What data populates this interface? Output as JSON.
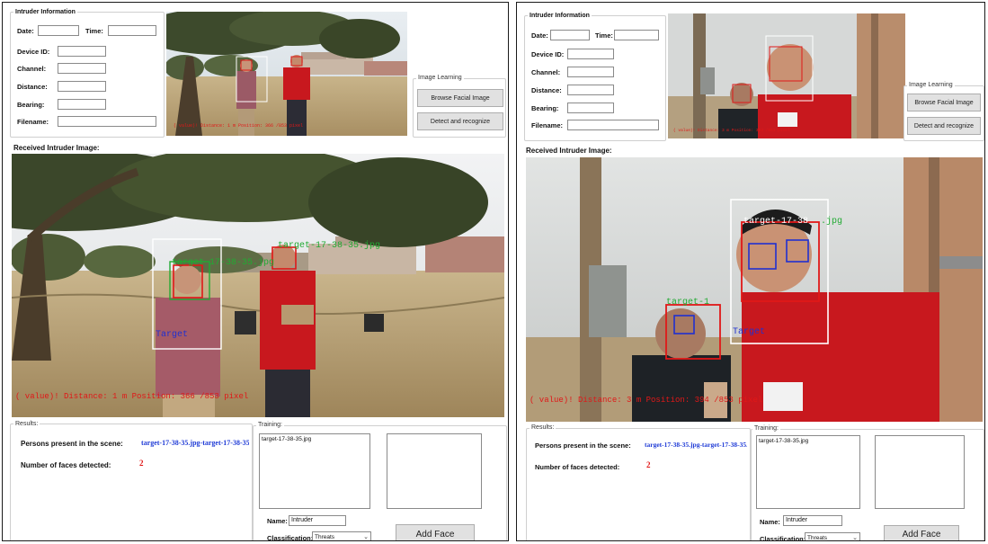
{
  "intruder": {
    "group_title": "Intruder Information",
    "date_label": "Date:",
    "time_label": "Time:",
    "device_label": "Device ID:",
    "channel_label": "Channel:",
    "distance_label": "Distance:",
    "bearing_label": "Bearing:",
    "filename_label": "Filename:"
  },
  "learning": {
    "group_title": "Image Learning",
    "browse_label": "Browse Facial Image",
    "detect_label": "Detect and recognize"
  },
  "received_label": "Received Intruder Image:",
  "overlays": {
    "left_tag1": "target-17-38-35.jpg",
    "left_tag2": "target-17-38-35.jpg",
    "right_tag1": "target-17-38",
    "right_tag2": "target-1",
    "jpg_frag": ".jpg",
    "target": "Target",
    "left_status": "( value)! Distance: 1 m Position: 366 /853 pixel",
    "right_status": "( value)! Distance: 3 m Position: 394 /853 pixel",
    "thumb_status": "( value)! Distance: 3 m Position: 394 /853 pixel"
  },
  "results": {
    "group_title": "Results:",
    "persons_label": "Persons present in the scene:",
    "persons_value": "target-17-38-35.jpg-target-17-38-35.jpg",
    "faces_label": "Number of faces detected:",
    "faces_value": "2"
  },
  "training": {
    "group_title": "Training:",
    "list_item": "target-17-38-35.jpg",
    "name_label": "Name:",
    "name_value": "Intruder",
    "class_label": "Classification:",
    "class_value": "Threats",
    "add_label": "Add Face"
  },
  "colors": {
    "face_box_red": "#e01818",
    "face_box_green": "#22aa33",
    "eye_box_blue": "#2030d0",
    "frame_box": "#ffffff",
    "result_blue": "#1f3bd6",
    "result_red": "#e01010",
    "shirt_red": "#c8181e"
  }
}
